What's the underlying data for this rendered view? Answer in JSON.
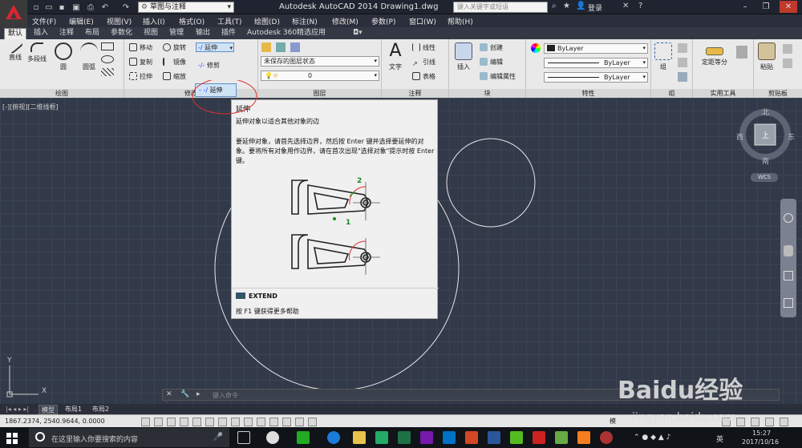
{
  "app": {
    "title": "Autodesk AutoCAD 2014    Drawing1.dwg",
    "workspace": "草图与注释",
    "search_placeholder": "键入关键字或短语",
    "login": "登录"
  },
  "menu": [
    "文件(F)",
    "编辑(E)",
    "视图(V)",
    "插入(I)",
    "格式(O)",
    "工具(T)",
    "绘图(D)",
    "标注(N)",
    "修改(M)",
    "参数(P)",
    "窗口(W)",
    "帮助(H)"
  ],
  "ribbon_tabs": [
    "默认",
    "插入",
    "注释",
    "布局",
    "参数化",
    "视图",
    "管理",
    "输出",
    "插件",
    "Autodesk 360",
    "精选应用"
  ],
  "ribbon": {
    "draw": {
      "label": "绘图",
      "line": "直线",
      "polyline": "多段线",
      "circle": "圆",
      "arc": "圆弧"
    },
    "modify": {
      "label": "修改",
      "move": "移动",
      "rotate": "旋转",
      "copy": "复制",
      "mirror": "镜像",
      "stretch": "拉伸",
      "scale": "缩放",
      "extend": "延伸",
      "trim": "修剪",
      "extend_popup": "延伸"
    },
    "layers": {
      "label": "图层",
      "state": "未保存的图层状态",
      "layer": "0"
    },
    "annotation": {
      "label": "注释",
      "text": "文字",
      "linear": "线性",
      "leader": "引线",
      "table": "表格"
    },
    "block": {
      "label": "块",
      "insert": "插入",
      "create": "创建",
      "edit": "编辑",
      "edit_attr": "编辑属性"
    },
    "properties": {
      "label": "特性",
      "color": "ByLayer",
      "linetype": "ByLayer",
      "lineweight": "ByLayer"
    },
    "groups": {
      "label": "组",
      "group": "组"
    },
    "utilities": {
      "label": "实用工具",
      "measure": "定距等分"
    },
    "clipboard": {
      "label": "剪贴板",
      "paste": "粘贴"
    }
  },
  "viewport": {
    "label": "[-][俯视][二维线框]",
    "north": "北",
    "south": "南",
    "east": "东",
    "west": "西",
    "top": "上",
    "wcs": "WCS"
  },
  "tooltip": {
    "title": "延伸",
    "desc": "延伸对象以适合其他对象的边",
    "long": "要延伸对象，请首先选择边界，然后按 Enter 键并选择要延伸的对象。要将所有对象用作边界，请在首次出现\"选择对象\"提示时按 Enter 键。",
    "callout1": "1",
    "callout2": "2",
    "command": "EXTEND",
    "help": "按 F1 键获得更多帮助"
  },
  "cmdline": {
    "placeholder": "键入命令"
  },
  "layout_tabs": [
    "模型",
    "布局1",
    "布局2"
  ],
  "status": {
    "coords": "1867.2374, 2540.9644, 0.0000",
    "model": "模"
  },
  "taskbar": {
    "search": "在这里输入你要搜索的内容",
    "ime": "英",
    "time": "15:27",
    "date": "2017/10/16"
  },
  "watermark": {
    "text": "Baidu经验",
    "url": "jingyan.baidu.com"
  }
}
